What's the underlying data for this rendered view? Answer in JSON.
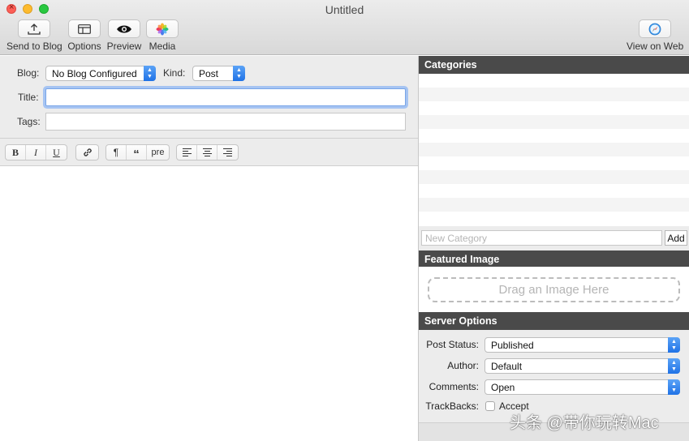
{
  "window": {
    "title": "Untitled"
  },
  "toolbar": {
    "send_to_blog": "Send to Blog",
    "options": "Options",
    "preview": "Preview",
    "media": "Media",
    "view_on_web": "View on Web"
  },
  "post_meta": {
    "blog_label": "Blog:",
    "blog_value": "No Blog Configured",
    "kind_label": "Kind:",
    "kind_value": "Post",
    "title_label": "Title:",
    "title_value": "",
    "tags_label": "Tags:",
    "tags_value": ""
  },
  "format_bar": {
    "bold": "B",
    "italic": "I",
    "underline": "U",
    "paragraph": "¶",
    "quote": "“",
    "pre": "pre"
  },
  "categories": {
    "header": "Categories",
    "new_category_placeholder": "New Category",
    "add_button": "Add"
  },
  "featured_image": {
    "header": "Featured Image",
    "dropzone_text": "Drag an Image Here"
  },
  "server_options": {
    "header": "Server Options",
    "post_status_label": "Post Status:",
    "post_status_value": "Published",
    "author_label": "Author:",
    "author_value": "Default",
    "comments_label": "Comments:",
    "comments_value": "Open",
    "trackbacks_label": "TrackBacks:",
    "accept_label": "Accept"
  },
  "watermark": {
    "text": "头条 @带你玩转Mac"
  },
  "colors": {
    "section_header": "#4a4a4a",
    "focus_ring": "#a6c4f2",
    "popup_accent": "#1f72e6"
  }
}
